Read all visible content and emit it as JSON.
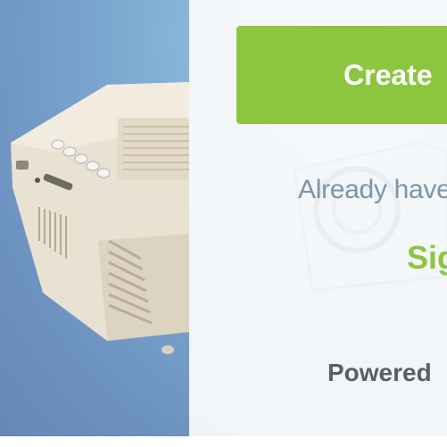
{
  "colors": {
    "accent_green": "#8cc63f",
    "panel_bg": "#fafbfc",
    "muted_text": "#7d95a6",
    "dark_text": "#5b5f63"
  },
  "hero": {
    "image_subject": "mini-projector-photo"
  },
  "actions": {
    "create_label": "Create",
    "already_text": "Already have",
    "signin_label": "Sig"
  },
  "footer": {
    "powered_text": "Powered"
  }
}
